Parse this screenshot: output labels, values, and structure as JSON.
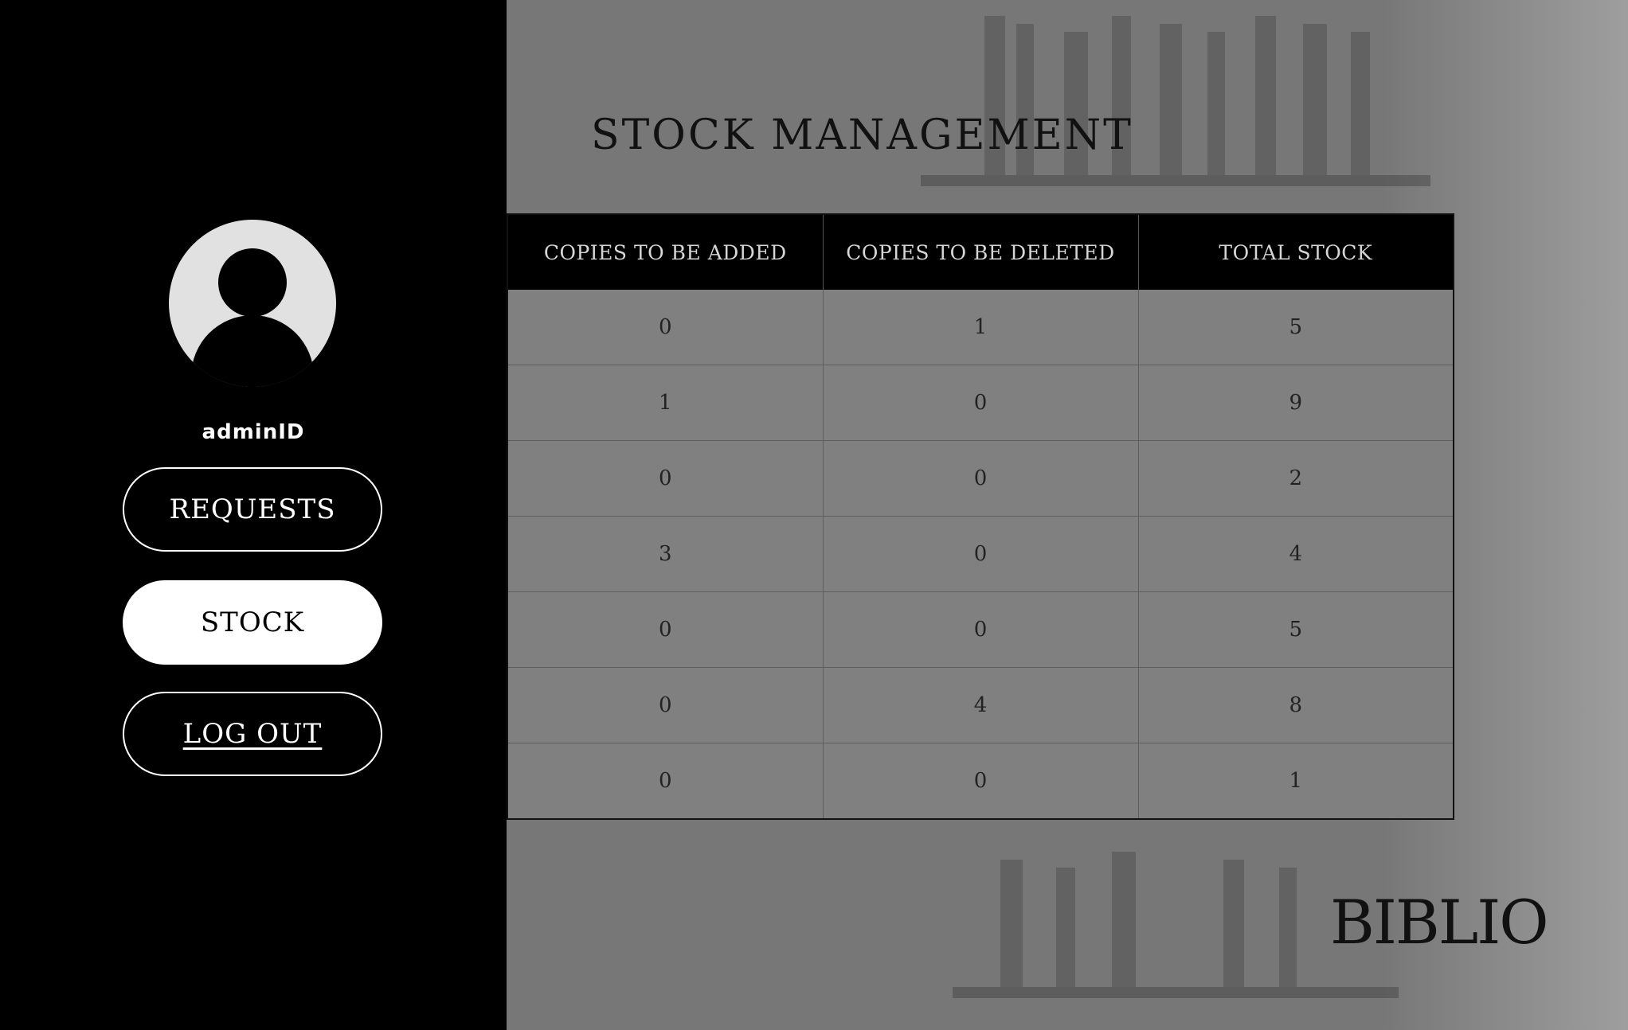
{
  "sidebar": {
    "username": "adminID",
    "nav": {
      "requests_label": "REQUESTS",
      "stock_label": "STOCK",
      "logout_label": "LOG OUT"
    },
    "active_item": "STOCK"
  },
  "main": {
    "title": "STOCK MANAGEMENT",
    "table": {
      "headers": [
        "COPIES TO BE ADDED",
        "COPIES TO BE DELETED",
        "TOTAL STOCK"
      ],
      "rows": [
        [
          "0",
          "1",
          "5"
        ],
        [
          "1",
          "0",
          "9"
        ],
        [
          "0",
          "0",
          "2"
        ],
        [
          "3",
          "0",
          "4"
        ],
        [
          "0",
          "0",
          "5"
        ],
        [
          "0",
          "4",
          "8"
        ],
        [
          "0",
          "0",
          "1"
        ]
      ]
    },
    "brand": "BIBLIO"
  },
  "colors": {
    "sidebar_bg": "#000000",
    "main_bg": "#777777",
    "table_header_bg": "#000000",
    "active_button_bg": "#ffffff"
  },
  "icons": {
    "avatar": "user-avatar-icon"
  }
}
